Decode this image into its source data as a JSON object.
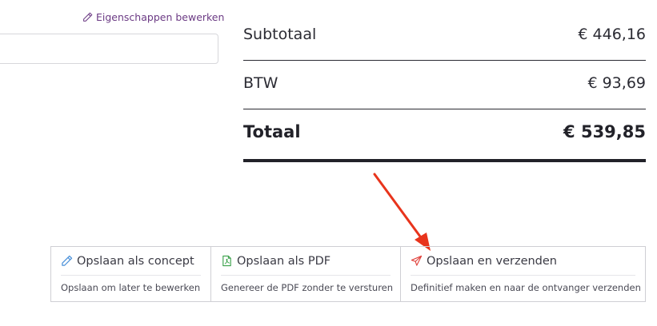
{
  "edit_properties": {
    "label": "Eigenschappen bewerken",
    "icon": "pencil-icon"
  },
  "totals": {
    "subtotal_label": "Subtotaal",
    "subtotal_value": "€ 446,16",
    "vat_label": "BTW",
    "vat_value": "€ 93,69",
    "total_label": "Totaal",
    "total_value": "€ 539,85"
  },
  "actions": [
    {
      "title": "Opslaan als concept",
      "description": "Opslaan om later te bewerken",
      "icon": "pencil-icon",
      "icon_color": "#4a90d9"
    },
    {
      "title": "Opslaan als PDF",
      "description": "Genereer de PDF zonder te versturen",
      "icon": "pdf-file-icon",
      "icon_color": "#3aa14a"
    },
    {
      "title": "Opslaan en verzenden",
      "description": "Definitief maken en naar de ontvanger verzenden",
      "icon": "paper-plane-icon",
      "icon_color": "#e0403a"
    }
  ],
  "colors": {
    "link": "#6b3a84",
    "annotation_arrow": "#e8341c"
  }
}
